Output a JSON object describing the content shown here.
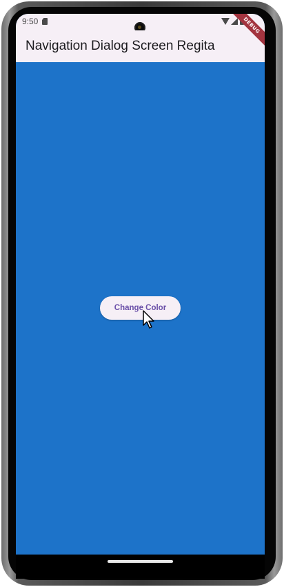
{
  "status_bar": {
    "time": "9:50",
    "icons": [
      "sim-card-icon",
      "wifi-icon",
      "signal-icon",
      "battery-icon"
    ]
  },
  "app_bar": {
    "title": "Navigation Dialog Screen Regita",
    "background": "#f6eff6"
  },
  "debug_banner": {
    "label": "DEBUG",
    "color": "#a3343f"
  },
  "main": {
    "background": "#1d73c9",
    "button_label": "Change Color",
    "button_text_color": "#6a4fa8"
  }
}
